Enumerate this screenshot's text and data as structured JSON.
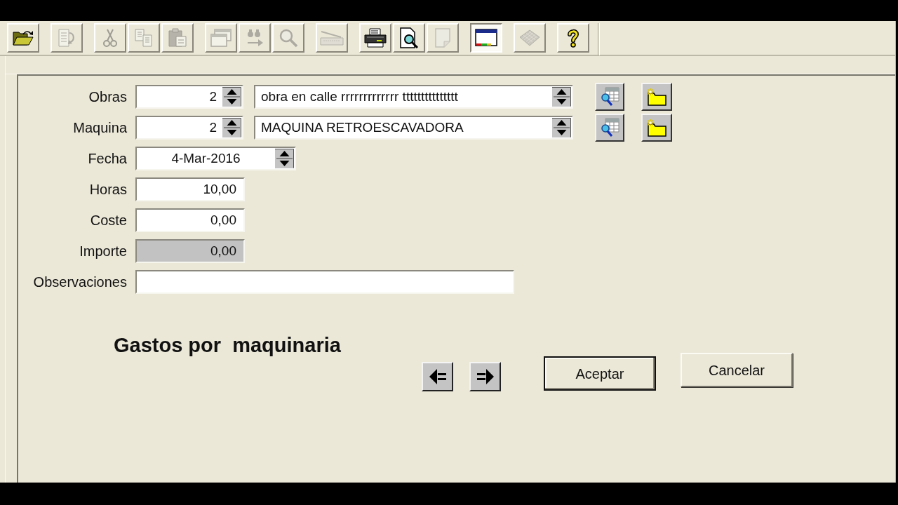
{
  "toolbar": {
    "groups": [
      [
        {
          "kind": "open",
          "disabled": false,
          "pressed": false
        }
      ],
      [
        {
          "kind": "edit",
          "disabled": true,
          "pressed": false
        }
      ],
      [
        {
          "kind": "cut",
          "disabled": true,
          "pressed": false
        },
        {
          "kind": "copy",
          "disabled": true,
          "pressed": false
        },
        {
          "kind": "paste",
          "disabled": true,
          "pressed": false
        }
      ],
      [
        {
          "kind": "windows",
          "disabled": true,
          "pressed": false
        },
        {
          "kind": "replace",
          "disabled": true,
          "pressed": false
        },
        {
          "kind": "zoom",
          "disabled": true,
          "pressed": false
        }
      ],
      [
        {
          "kind": "scan",
          "disabled": true,
          "pressed": false
        }
      ],
      [
        {
          "kind": "print",
          "disabled": false,
          "pressed": false
        },
        {
          "kind": "preview",
          "disabled": false,
          "pressed": false
        },
        {
          "kind": "page",
          "disabled": true,
          "pressed": false
        }
      ],
      [
        {
          "kind": "screen",
          "disabled": false,
          "pressed": true
        }
      ],
      [
        {
          "kind": "grid",
          "disabled": true,
          "pressed": false
        }
      ],
      [
        {
          "kind": "help",
          "disabled": false,
          "pressed": false
        }
      ]
    ]
  },
  "form": {
    "fields": [
      {
        "label": "Obras",
        "kind": "lookup",
        "code": "2",
        "description": "obra en calle rrrrrrrrrrrrr ttttttttttttttt",
        "disabled": false
      },
      {
        "label": "Maquina",
        "kind": "lookup",
        "code": "2",
        "description": "MAQUINA RETROESCAVADORA",
        "disabled": false
      },
      {
        "label": "Fecha",
        "kind": "date",
        "value": "4-Mar-2016",
        "disabled": false
      },
      {
        "label": "Horas",
        "kind": "number",
        "value": "10,00",
        "disabled": false
      },
      {
        "label": "Coste",
        "kind": "number",
        "value": "0,00",
        "disabled": false
      },
      {
        "label": "Importe",
        "kind": "number",
        "value": "0,00",
        "disabled": true
      },
      {
        "label": "Observaciones",
        "kind": "text",
        "disabled": false
      }
    ]
  },
  "title": "Gastos por  maquinaria",
  "buttons": [
    {
      "label": "Aceptar",
      "default": true
    },
    {
      "label": "Cancelar",
      "default": false
    }
  ]
}
